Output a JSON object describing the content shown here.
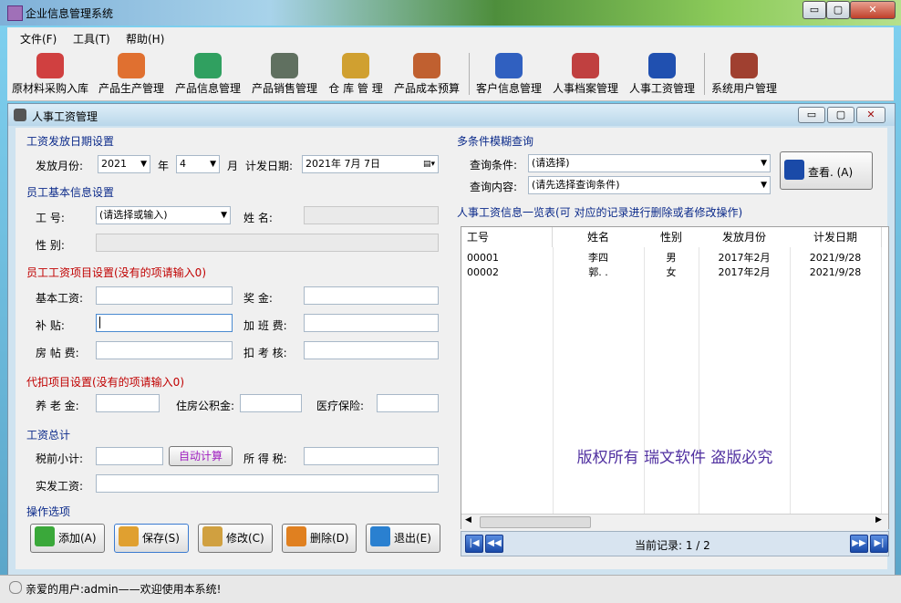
{
  "app": {
    "title": "企业信息管理系统"
  },
  "window_buttons": {
    "min": "▭",
    "max": "▢",
    "close": "✕"
  },
  "menu": [
    {
      "label": "文件(F)"
    },
    {
      "label": "工具(T)"
    },
    {
      "label": "帮助(H)"
    }
  ],
  "toolbar": [
    {
      "label": "原材料采购入库",
      "icon": "cubes-icon",
      "color": "#d04040"
    },
    {
      "label": "产品生产管理",
      "icon": "blocks-icon",
      "color": "#e07030"
    },
    {
      "label": "产品信息管理",
      "icon": "document-icon",
      "color": "#30a060"
    },
    {
      "label": "产品销售管理",
      "icon": "money-bag-icon",
      "color": "#607060"
    },
    {
      "label": "仓 库 管 理",
      "icon": "warehouse-icon",
      "color": "#d0a030"
    },
    {
      "label": "产品成本预算",
      "icon": "box-icon",
      "color": "#c06030"
    },
    {
      "label": "客户信息管理",
      "icon": "people-icon",
      "color": "#3060c0"
    },
    {
      "label": "人事档案管理",
      "icon": "files-icon",
      "color": "#c04040"
    },
    {
      "label": "人事工资管理",
      "icon": "payroll-icon",
      "color": "#2050b0"
    },
    {
      "label": "系统用户管理",
      "icon": "user-icon",
      "color": "#a04030"
    }
  ],
  "inner": {
    "title": "人事工资管理"
  },
  "left": {
    "sec_date": "工资发放日期设置",
    "pay_month_label": "发放月份:",
    "year": "2021",
    "year_unit": "年",
    "month": "4",
    "month_unit": "月",
    "calc_date_label": "计发日期:",
    "calc_date": "2021年 7月 7日",
    "sec_emp": "员工基本信息设置",
    "emp_no_label": "工    号:",
    "emp_no_value": "(请选择或输入)",
    "name_label": "姓    名:",
    "gender_label": "性    别:",
    "sec_items": "员工工资项目设置(没有的项请输入0)",
    "base_label": "基本工资:",
    "bonus_label": "奖    金:",
    "subsidy_label": "补    贴:",
    "overtime_label": "加 班 费:",
    "rent_label": "房 帖 费:",
    "deduct_label": "扣 考 核:",
    "sec_withhold": "代扣项目设置(没有的项请输入0)",
    "pension_label": "养 老 金:",
    "housing_label": "住房公积金:",
    "medical_label": "医疗保险:",
    "sec_total": "工资总计",
    "pretax_label": "税前小计:",
    "auto_calc": "自动计算",
    "tax_label": "所 得 税:",
    "net_label": "实发工资:",
    "sec_ops": "操作选项",
    "btn_add": "添加(A)",
    "btn_save": "保存(S)",
    "btn_edit": "修改(C)",
    "btn_delete": "删除(D)",
    "btn_exit": "退出(E)"
  },
  "right": {
    "sec_query": "多条件模糊查询",
    "cond_label": "查询条件:",
    "cond_value": "(请选择)",
    "content_label": "查询内容:",
    "content_value": "(请先选择查询条件)",
    "view_btn": "查看.  (A)",
    "list_title": "人事工资信息一览表(可     对应的记录进行删除或者修改操作)",
    "columns": [
      "工号",
      "姓名",
      "性别",
      "发放月份",
      "计发日期"
    ],
    "rows": [
      [
        "00001",
        "李四",
        "男",
        "2017年2月",
        "2021/9/28"
      ],
      [
        "00002",
        "郭. .",
        "女",
        "2017年2月",
        "2021/9/28"
      ]
    ],
    "watermark": "版权所有  瑞文软件  盗版必究",
    "record_label": "当前记录: 1 / 2"
  },
  "status": {
    "text": "亲爱的用户:admin——欢迎使用本系统!"
  }
}
